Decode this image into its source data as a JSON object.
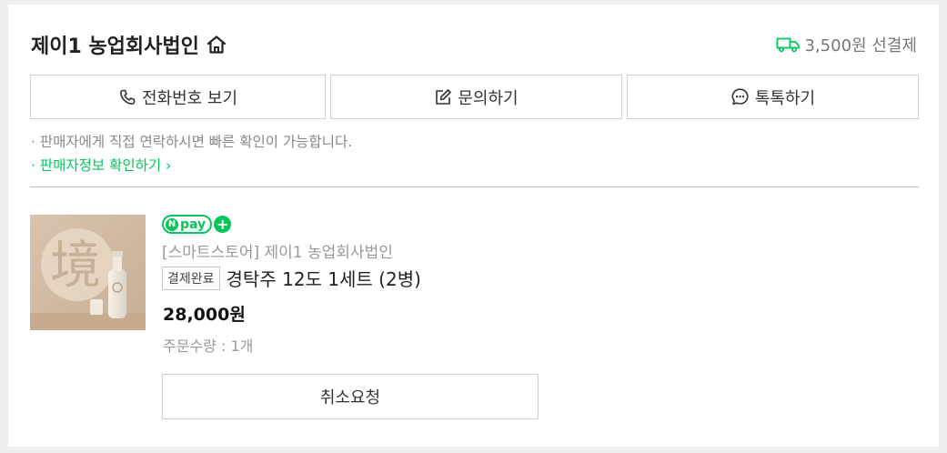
{
  "seller": {
    "name": "제이1 농업회사법인",
    "home_icon": "home-icon"
  },
  "shipping": {
    "icon": "truck-icon",
    "color": "#03c75a",
    "text": "3,500원 선결제"
  },
  "contact_buttons": [
    {
      "label": "전화번호 보기",
      "icon": "phone-icon"
    },
    {
      "label": "문의하기",
      "icon": "edit-icon"
    },
    {
      "label": "톡톡하기",
      "icon": "chat-icon"
    }
  ],
  "notes": {
    "contact_note": "· 판매자에게 직접 연락하시면 빠른 확인이 가능합니다.",
    "seller_info_link": "· 판매자정보 확인하기 ›"
  },
  "order": {
    "thumbnail_glyph": "境",
    "npay": {
      "n": "N",
      "text": "pay",
      "plus": "+",
      "color": "#03c75a"
    },
    "store": "[스마트스토어] 제이1 농업회사법인",
    "status": "결제완료",
    "product_name": "경탁주 12도 1세트 (2병)",
    "price": "28,000원",
    "quantity": "주문수량 : 1개",
    "cancel_label": "취소요청"
  }
}
